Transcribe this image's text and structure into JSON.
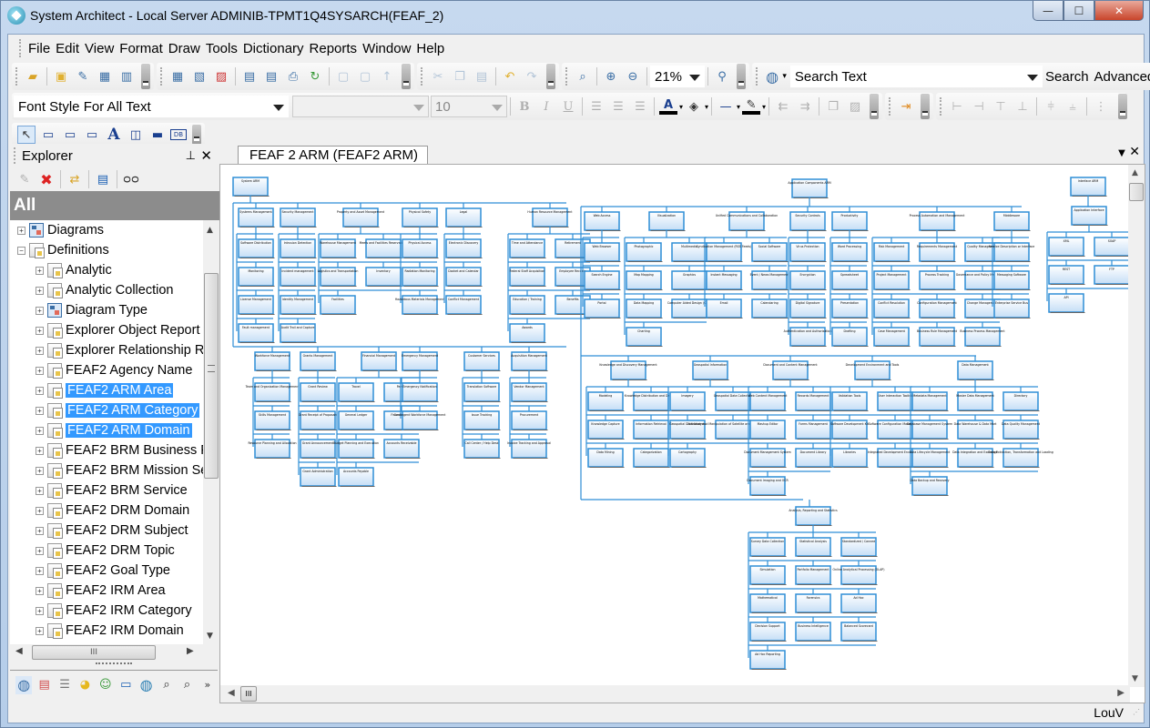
{
  "window": {
    "title": "System Architect - Local Server ADMINIB-TPMT1Q4SYSARCH(FEAF_2)",
    "minimize_label": "—",
    "maximize_label": "☐",
    "close_label": "✕"
  },
  "menubar": [
    {
      "label": "File",
      "mnemonic": "F"
    },
    {
      "label": "Edit",
      "mnemonic": "E"
    },
    {
      "label": "View",
      "mnemonic": "V"
    },
    {
      "label": "Format",
      "mnemonic": "o"
    },
    {
      "label": "Draw",
      "mnemonic": "D"
    },
    {
      "label": "Tools",
      "mnemonic": "T"
    },
    {
      "label": "Dictionary",
      "mnemonic": "c"
    },
    {
      "label": "Reports",
      "mnemonic": "R"
    },
    {
      "label": "Window",
      "mnemonic": "W"
    },
    {
      "label": "Help",
      "mnemonic": "H"
    }
  ],
  "toolbar": {
    "zoom_value": "21%",
    "search_placeholder": "Search Text",
    "search_label": "Search",
    "advanced_label": "Advanced...",
    "font_style_value": "Font Style For All Text",
    "font_name_value": "",
    "font_size_value": "10",
    "bold": "B",
    "italic": "I",
    "underline": "U"
  },
  "explorer": {
    "title": "Explorer",
    "pin": "⊥",
    "close": "✕",
    "filter_label": "All",
    "tree": [
      {
        "label": "Diagrams",
        "level": 0,
        "expanded": false,
        "icon": "diagram-icon",
        "selected": false
      },
      {
        "label": "Definitions",
        "level": 0,
        "expanded": true,
        "icon": "definitions-icon",
        "selected": false
      },
      {
        "label": "Analytic",
        "level": 1,
        "icon": "analytic-icon",
        "selected": false
      },
      {
        "label": "Analytic Collection",
        "level": 1,
        "icon": "analytic-collection-icon",
        "selected": false
      },
      {
        "label": "Diagram Type",
        "level": 1,
        "icon": "diagram-type-icon",
        "selected": false
      },
      {
        "label": "Explorer Object Report",
        "level": 1,
        "icon": "report-icon",
        "selected": false
      },
      {
        "label": "Explorer Relationship Re",
        "level": 1,
        "icon": "relationship-report-icon",
        "selected": false
      },
      {
        "label": "FEAF2 Agency Name",
        "level": 1,
        "icon": "definition-icon",
        "selected": false
      },
      {
        "label": "FEAF2 ARM Area",
        "level": 1,
        "icon": "definition-icon",
        "selected": true
      },
      {
        "label": "FEAF2 ARM Category",
        "level": 1,
        "icon": "definition-icon",
        "selected": true
      },
      {
        "label": "FEAF2 ARM Domain",
        "level": 1,
        "icon": "definition-icon",
        "selected": true
      },
      {
        "label": "FEAF2 BRM Business Fu",
        "level": 1,
        "icon": "definition-icon",
        "selected": false
      },
      {
        "label": "FEAF2 BRM Mission Sec",
        "level": 1,
        "icon": "definition-icon",
        "selected": false
      },
      {
        "label": "FEAF2 BRM Service",
        "level": 1,
        "icon": "definition-icon",
        "selected": false
      },
      {
        "label": "FEAF2 DRM Domain",
        "level": 1,
        "icon": "definition-icon",
        "selected": false
      },
      {
        "label": "FEAF2 DRM Subject",
        "level": 1,
        "icon": "definition-icon",
        "selected": false
      },
      {
        "label": "FEAF2 DRM Topic",
        "level": 1,
        "icon": "definition-icon",
        "selected": false
      },
      {
        "label": "FEAF2 Goal Type",
        "level": 1,
        "icon": "definition-icon",
        "selected": false
      },
      {
        "label": "FEAF2 IRM Area",
        "level": 1,
        "icon": "definition-icon",
        "selected": false
      },
      {
        "label": "FEAF2 IRM Category",
        "level": 1,
        "icon": "definition-icon",
        "selected": false
      },
      {
        "label": "FEAF2 IRM Domain",
        "level": 1,
        "icon": "definition-icon",
        "selected": false
      }
    ],
    "hscroll_grip": "III",
    "more_label": "»"
  },
  "document": {
    "tab_label": "FEAF 2 ARM (FEAF2 ARM)",
    "hscroll_grip": "III",
    "diagram": {
      "roots": [
        {
          "label": "System ARM",
          "children": [
            {
              "label": "Systems Management",
              "children": [
                "Software Distribution",
                "Monitoring",
                "License Management",
                "Fault management"
              ]
            },
            {
              "label": "Security Management",
              "children": [
                "Intrusion Detection",
                "Incident management",
                "Identity Management",
                "Audit Trail and Capture"
              ]
            },
            {
              "label": "Property and Asset Management",
              "children": [
                "Warehouse Management",
                "Meets and Facilities Reservations",
                "Logistics and Transportation",
                "Inventory",
                "Facilities"
              ]
            },
            {
              "label": "Physical Safety",
              "children": [
                "Physical Access",
                "Radiation Monitoring",
                "Hazardous Materials Management"
              ]
            },
            {
              "label": "Legal",
              "children": [
                "Electronic Discovery",
                "Docket and Calendar",
                "Conflict Management"
              ]
            },
            {
              "label": "Human Resource Management",
              "children": [
                "Time and Attendance",
                "Retirement",
                "Federal Staff Acquisition",
                "Employee Records",
                "Education / Training",
                "Benefits",
                "Awards"
              ]
            },
            {
              "label": "Workforce Management",
              "children": [
                "Team and Organization Management",
                "Skills Management",
                "Resource Planning and Allocation"
              ]
            },
            {
              "label": "Grants Management",
              "children": [
                "Grant Review",
                "Grant Receipt of Proposals",
                "Grant Announcement",
                "Grant Administration"
              ]
            },
            {
              "label": "Financial Management",
              "children": [
                "Travel",
                "Payroll",
                "General Ledger",
                "Financial Audit",
                "Budget Planning and Execution",
                "Accounts Receivable",
                "Accounts Payable"
              ]
            },
            {
              "label": "Emergency Management",
              "children": [
                "Emergency Notification",
                "Contingent Workforce Management"
              ]
            },
            {
              "label": "Customer Services",
              "children": [
                "Translation Software",
                "Issue Tracking",
                "Call Center / Help Desk"
              ]
            },
            {
              "label": "Acquisition Management",
              "children": [
                "Vendor Management",
                "Procurement",
                "Invoice Tracking and Approval"
              ]
            }
          ]
        },
        {
          "label": "Application Components ARM",
          "children": [
            {
              "label": "Web Access",
              "children": [
                "Web Browser",
                "Search Engine",
                "Portal"
              ]
            },
            {
              "label": "Visualization",
              "children": [
                "Photographic",
                "Multimedia",
                "Map Mapping",
                "Graphics",
                "Data Mapping",
                "Computer Aided Design (CAD)",
                "Charting"
              ]
            },
            {
              "label": "Unified Communications and Collaboration",
              "children": [
                "Syndication Management (RSS Feeds)",
                "Social Software",
                "Instant Messaging",
                "Event / News Management",
                "Email",
                "Calendaring"
              ]
            },
            {
              "label": "Security Controls",
              "children": [
                "Virus Protection",
                "Encryption",
                "Digital Signature",
                "Authentication and Authorization"
              ]
            },
            {
              "label": "Productivity",
              "children": [
                "Word Processing",
                "Spreadsheet",
                "Presentation",
                "Drafting"
              ]
            },
            {
              "label": "Process Automation and Management",
              "children": [
                "Risk Management",
                "Requirements Management",
                "Quality Management",
                "Project Management",
                "Process Tracking",
                "Governance and Policy Management",
                "Conflict Resolution",
                "Configuration Management",
                "Change Management",
                "Case Management",
                "Business Rule Management",
                "Business Process Management"
              ]
            },
            {
              "label": "Middleware",
              "children": [
                "Service Description or Interface",
                "Messaging Software",
                "Enterprise Service Bus"
              ]
            },
            {
              "label": "Knowledge and Discovery Management",
              "children": [
                "Modeling",
                "Knowledge Distribution and Delivery",
                "Knowledge Capture",
                "Information Retrieval",
                "Data Mining",
                "Categorization"
              ]
            },
            {
              "label": "Geospatial Information",
              "children": [
                "Imagery",
                "Geospatial Data Collection",
                "Geospatial Data Analysis",
                "Collection and Manipulation of Satellite and Aerial Photographs",
                "Cartography"
              ]
            },
            {
              "label": "Document and Content Management",
              "children": [
                "Web Content Management",
                "Records Management",
                "Mashup Editor",
                "Forms Management",
                "Document Management System",
                "Document Library",
                "Document Imaging and OCR"
              ]
            },
            {
              "label": "Development Environment and Tools",
              "children": [
                "Validation Tools",
                "User Interaction Toolkit",
                "Software Development Kit",
                "Software Configuration Management",
                "Libraries",
                "Integrated Development Environment"
              ]
            },
            {
              "label": "Data Management",
              "children": [
                "Metadata Management",
                "Master Data Management",
                "Directory",
                "Database Management System",
                "Data Warehouse & Data Mart",
                "Data Quality Management",
                "Data Lifecycle Management",
                "Data Integration and Exchange",
                "Data Extraction, Transformation and Loading",
                "Data Backup and Recovery"
              ]
            },
            {
              "label": "Analysis, Reporting and Statistics",
              "children": [
                "Survey Data Collection",
                "Statistical Analysis",
                "Standardized / Canned",
                "Simulation",
                "Portfolio Management",
                "Online Analytical Processing (OLAP)",
                "Mathematical",
                "Forensics",
                "Ad Hoc",
                "Decision Support",
                "Business Intelligence",
                "Balanced Scorecard",
                "Ad Hoc Reporting"
              ]
            }
          ]
        },
        {
          "label": "Interface ARM",
          "children": [
            {
              "label": "Application Interface",
              "children": [
                "XML",
                "SOAP",
                "REST",
                "FTP",
                "API"
              ]
            }
          ]
        }
      ]
    }
  },
  "status": {
    "user": "LouV"
  }
}
